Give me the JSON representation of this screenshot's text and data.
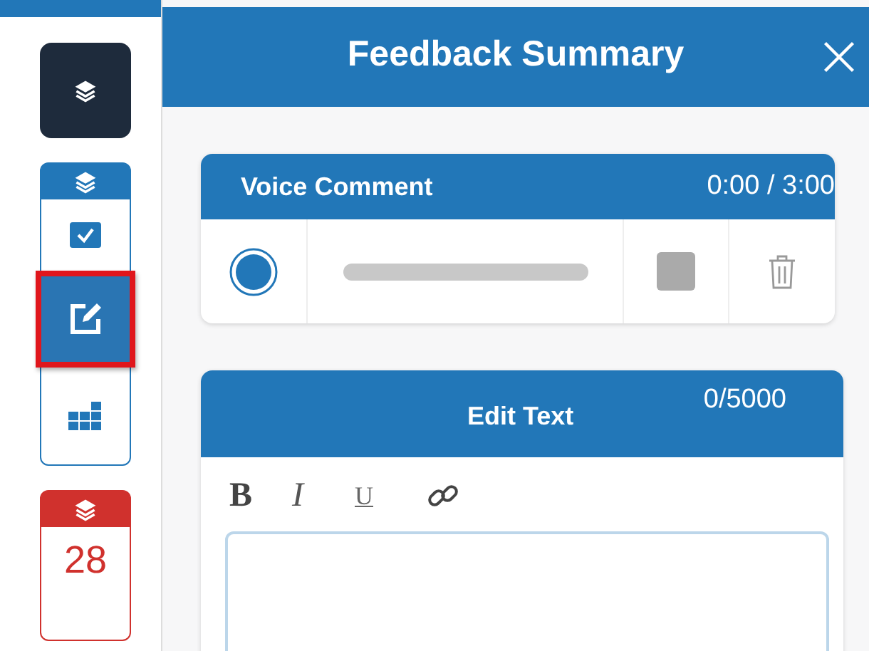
{
  "sidebar": {
    "groups": [
      {
        "kind": "dark"
      },
      {
        "kind": "blue",
        "items": [
          {
            "kind": "check",
            "selected": false
          },
          {
            "kind": "edit",
            "selected": true
          },
          {
            "kind": "grid",
            "selected": false
          }
        ]
      },
      {
        "kind": "red",
        "count": "28"
      }
    ]
  },
  "panel": {
    "title": "Feedback Summary"
  },
  "voice_comment": {
    "title": "Voice Comment",
    "time": "0:00 / 3:00"
  },
  "edit_text": {
    "title": "Edit Text",
    "count": "0/5000",
    "toolbar": [
      {
        "kind": "bold",
        "label": "B"
      },
      {
        "kind": "italic",
        "label": "I"
      },
      {
        "kind": "underline",
        "label": "U"
      },
      {
        "kind": "link"
      }
    ]
  }
}
